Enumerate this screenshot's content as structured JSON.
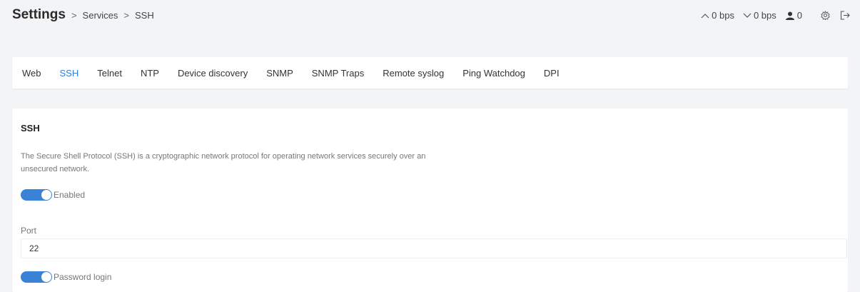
{
  "breadcrumb": {
    "title": "Settings",
    "sep1": ">",
    "item1": "Services",
    "sep2": ">",
    "item2": "SSH"
  },
  "status": {
    "upload": "0 bps",
    "download": "0 bps",
    "users": "0",
    "upload_icon": "chevron-up-icon",
    "download_icon": "chevron-down-icon",
    "user_icon": "user-icon",
    "settings_icon": "gear-icon",
    "logout_icon": "logout-icon"
  },
  "tabs": [
    {
      "label": "Web"
    },
    {
      "label": "SSH",
      "active": true
    },
    {
      "label": "Telnet"
    },
    {
      "label": "NTP"
    },
    {
      "label": "Device discovery"
    },
    {
      "label": "SNMP"
    },
    {
      "label": "SNMP Traps"
    },
    {
      "label": "Remote syslog"
    },
    {
      "label": "Ping Watchdog"
    },
    {
      "label": "DPI"
    }
  ],
  "panel": {
    "title": "SSH",
    "description": "The Secure Shell Protocol (SSH) is a cryptographic network protocol for operating network services securely over an unsecured network.",
    "enabled_label": "Enabled",
    "enabled": true,
    "port_label": "Port",
    "port_value": "22",
    "password_login_label": "Password login",
    "password_login": true
  },
  "colors": {
    "accent": "#3a82d6",
    "active_tab": "#2f7fd3",
    "background": "#f3f4f6"
  }
}
